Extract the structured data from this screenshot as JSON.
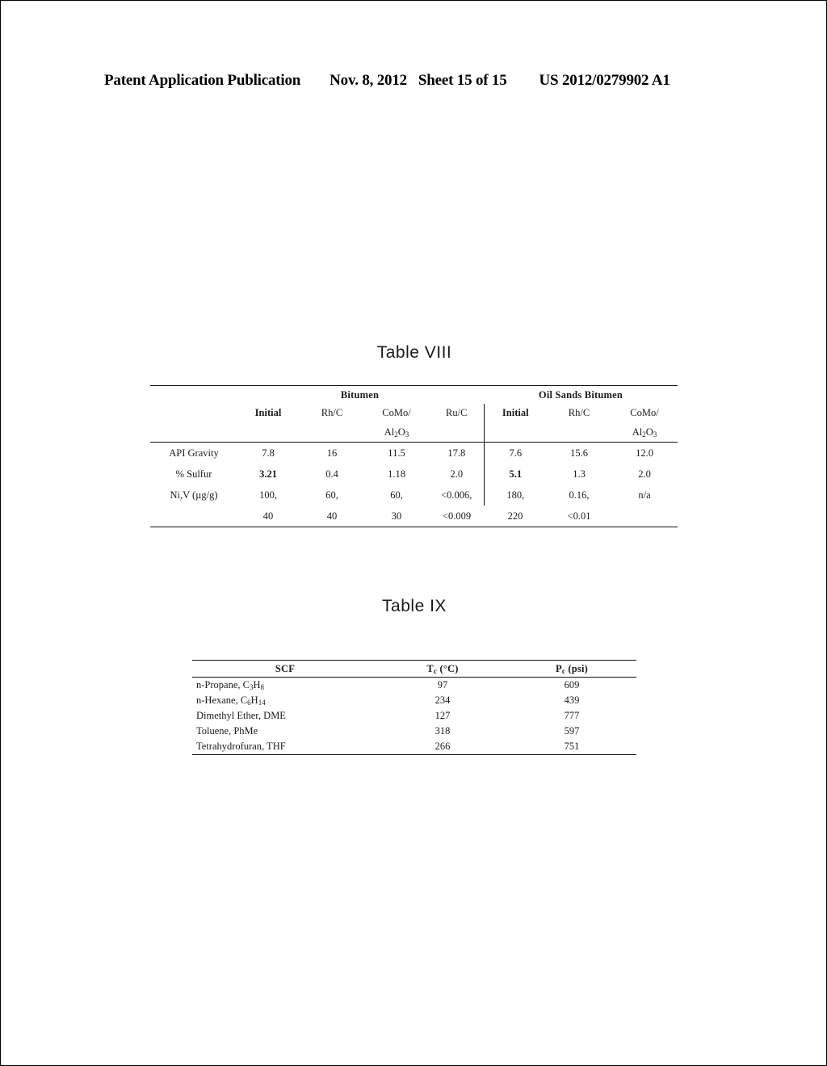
{
  "header": {
    "publication": "Patent Application Publication",
    "date": "Nov. 8, 2012",
    "sheet": "Sheet 15 of 15",
    "patent_number": "US 2012/0279902 A1"
  },
  "table_viii": {
    "title": "Table VIII",
    "group_headers": [
      {
        "label": "Bitumen",
        "span": 4
      },
      {
        "label": "Oil Sands Bitumen",
        "span": 3
      }
    ],
    "column_headers": [
      "",
      "Initial",
      "Rh/C",
      "CoMo/",
      "Ru/C",
      "Initial",
      "Rh/C",
      "CoMo/"
    ],
    "column_headers_sub": [
      "",
      "",
      "",
      "Al2O3",
      "",
      "",
      "",
      "Al2O3"
    ],
    "rows": [
      {
        "label": "API Gravity",
        "values": [
          "7.8",
          "16",
          "11.5",
          "17.8",
          "7.6",
          "15.6",
          "12.0"
        ]
      },
      {
        "label": "% Sulfur",
        "values": [
          "3.21",
          "0.4",
          "1.18",
          "2.0",
          "5.1",
          "1.3",
          "2.0"
        ]
      },
      {
        "label": "Ni,V (µg/g)",
        "values": [
          "100,",
          "60,",
          "60,",
          "<0.006,",
          "180,",
          "0.16,",
          "n/a"
        ]
      },
      {
        "label": "",
        "values": [
          "40",
          "40",
          "30",
          "<0.009",
          "220",
          "<0.01",
          ""
        ]
      }
    ]
  },
  "table_ix": {
    "title": "Table IX",
    "column_headers": [
      "SCF",
      "Tc (°C)",
      "Pc (psi)"
    ],
    "rows": [
      {
        "scf": "n-Propane, C3H8",
        "tc": "97",
        "pc": "609"
      },
      {
        "scf": "n-Hexane, C6H14",
        "tc": "234",
        "pc": "439"
      },
      {
        "scf": "Dimethyl Ether, DME",
        "tc": "127",
        "pc": "777"
      },
      {
        "scf": "Toluene, PhMe",
        "tc": "318",
        "pc": "597"
      },
      {
        "scf": "Tetrahydrofuran, THF",
        "tc": "266",
        "pc": "751"
      }
    ]
  }
}
